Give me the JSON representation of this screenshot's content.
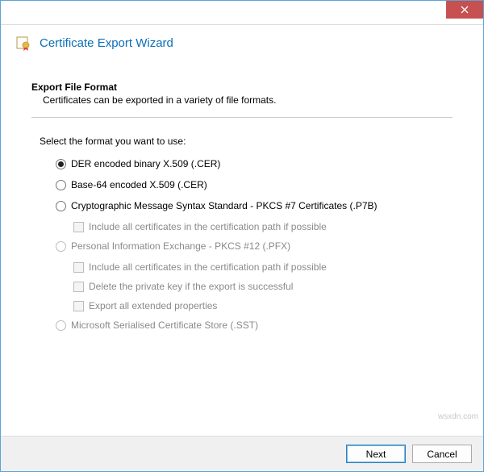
{
  "window": {
    "title": "Certificate Export Wizard"
  },
  "section": {
    "heading": "Export File Format",
    "sub": "Certificates can be exported in a variety of file formats."
  },
  "prompt": "Select the format you want to use:",
  "options": {
    "der": {
      "label": "DER encoded binary X.509 (.CER)",
      "checked": true,
      "disabled": false
    },
    "b64": {
      "label": "Base-64 encoded X.509 (.CER)",
      "checked": false,
      "disabled": false
    },
    "pkcs7": {
      "label": "Cryptographic Message Syntax Standard - PKCS #7 Certificates (.P7B)",
      "checked": false,
      "disabled": false
    },
    "pkcs7_includeChain": {
      "label": "Include all certificates in the certification path if possible",
      "disabled": true
    },
    "pfx": {
      "label": "Personal Information Exchange - PKCS #12 (.PFX)",
      "checked": false,
      "disabled": true
    },
    "pfx_includeChain": {
      "label": "Include all certificates in the certification path if possible",
      "disabled": true
    },
    "pfx_deleteKey": {
      "label": "Delete the private key if the export is successful",
      "disabled": true
    },
    "pfx_exportExt": {
      "label": "Export all extended properties",
      "disabled": true
    },
    "sst": {
      "label": "Microsoft Serialised Certificate Store (.SST)",
      "checked": false,
      "disabled": true
    }
  },
  "buttons": {
    "next": "Next",
    "cancel": "Cancel"
  },
  "watermark": "wsxdn.com"
}
